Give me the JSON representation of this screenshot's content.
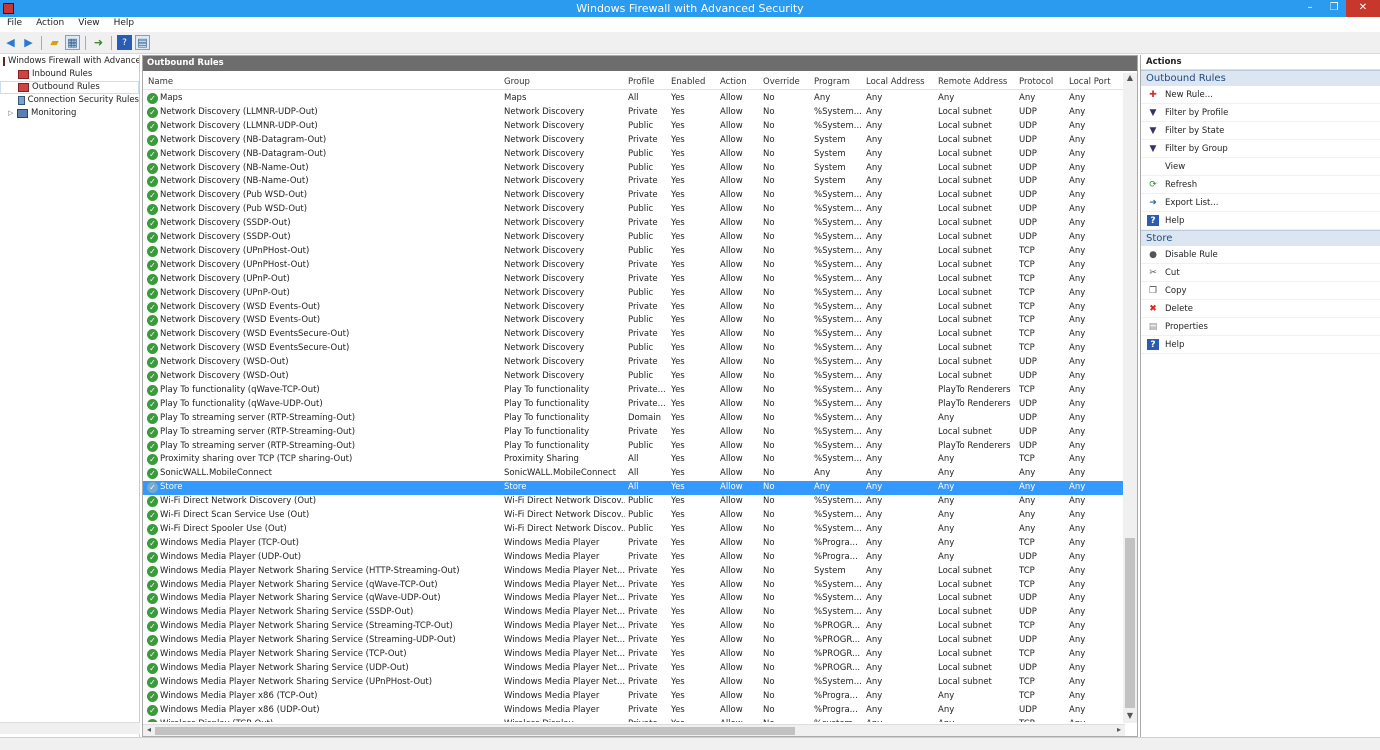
{
  "window": {
    "title": "Windows Firewall with Advanced Security",
    "controls": [
      "–",
      "❐",
      "✕"
    ]
  },
  "menu": [
    "File",
    "Action",
    "View",
    "Help"
  ],
  "tree": {
    "items": [
      {
        "label": "Windows Firewall with Advance",
        "level": 0,
        "expand": ""
      },
      {
        "label": "Inbound Rules",
        "level": 1,
        "expand": ""
      },
      {
        "label": "Outbound Rules",
        "level": 1,
        "expand": ""
      },
      {
        "label": "Connection Security Rules",
        "level": 1,
        "expand": ""
      },
      {
        "label": "Monitoring",
        "level": 1,
        "expand": "▷"
      }
    ]
  },
  "panel": {
    "title": "Outbound Rules"
  },
  "columns": [
    "Name",
    "Group",
    "Profile",
    "Enabled",
    "Action",
    "Override",
    "Program",
    "Local Address",
    "Remote Address",
    "Protocol",
    "Local Port"
  ],
  "rows": [
    [
      "Maps",
      "Maps",
      "All",
      "Yes",
      "Allow",
      "No",
      "Any",
      "Any",
      "Any",
      "Any",
      "Any"
    ],
    [
      "Network Discovery (LLMNR-UDP-Out)",
      "Network Discovery",
      "Private",
      "Yes",
      "Allow",
      "No",
      "%System...",
      "Any",
      "Local subnet",
      "UDP",
      "Any"
    ],
    [
      "Network Discovery (LLMNR-UDP-Out)",
      "Network Discovery",
      "Public",
      "Yes",
      "Allow",
      "No",
      "%System...",
      "Any",
      "Local subnet",
      "UDP",
      "Any"
    ],
    [
      "Network Discovery (NB-Datagram-Out)",
      "Network Discovery",
      "Private",
      "Yes",
      "Allow",
      "No",
      "System",
      "Any",
      "Local subnet",
      "UDP",
      "Any"
    ],
    [
      "Network Discovery (NB-Datagram-Out)",
      "Network Discovery",
      "Public",
      "Yes",
      "Allow",
      "No",
      "System",
      "Any",
      "Local subnet",
      "UDP",
      "Any"
    ],
    [
      "Network Discovery (NB-Name-Out)",
      "Network Discovery",
      "Public",
      "Yes",
      "Allow",
      "No",
      "System",
      "Any",
      "Local subnet",
      "UDP",
      "Any"
    ],
    [
      "Network Discovery (NB-Name-Out)",
      "Network Discovery",
      "Private",
      "Yes",
      "Allow",
      "No",
      "System",
      "Any",
      "Local subnet",
      "UDP",
      "Any"
    ],
    [
      "Network Discovery (Pub WSD-Out)",
      "Network Discovery",
      "Private",
      "Yes",
      "Allow",
      "No",
      "%System...",
      "Any",
      "Local subnet",
      "UDP",
      "Any"
    ],
    [
      "Network Discovery (Pub WSD-Out)",
      "Network Discovery",
      "Public",
      "Yes",
      "Allow",
      "No",
      "%System...",
      "Any",
      "Local subnet",
      "UDP",
      "Any"
    ],
    [
      "Network Discovery (SSDP-Out)",
      "Network Discovery",
      "Private",
      "Yes",
      "Allow",
      "No",
      "%System...",
      "Any",
      "Local subnet",
      "UDP",
      "Any"
    ],
    [
      "Network Discovery (SSDP-Out)",
      "Network Discovery",
      "Public",
      "Yes",
      "Allow",
      "No",
      "%System...",
      "Any",
      "Local subnet",
      "UDP",
      "Any"
    ],
    [
      "Network Discovery (UPnPHost-Out)",
      "Network Discovery",
      "Public",
      "Yes",
      "Allow",
      "No",
      "%System...",
      "Any",
      "Local subnet",
      "TCP",
      "Any"
    ],
    [
      "Network Discovery (UPnPHost-Out)",
      "Network Discovery",
      "Private",
      "Yes",
      "Allow",
      "No",
      "%System...",
      "Any",
      "Local subnet",
      "TCP",
      "Any"
    ],
    [
      "Network Discovery (UPnP-Out)",
      "Network Discovery",
      "Private",
      "Yes",
      "Allow",
      "No",
      "%System...",
      "Any",
      "Local subnet",
      "TCP",
      "Any"
    ],
    [
      "Network Discovery (UPnP-Out)",
      "Network Discovery",
      "Public",
      "Yes",
      "Allow",
      "No",
      "%System...",
      "Any",
      "Local subnet",
      "TCP",
      "Any"
    ],
    [
      "Network Discovery (WSD Events-Out)",
      "Network Discovery",
      "Private",
      "Yes",
      "Allow",
      "No",
      "%System...",
      "Any",
      "Local subnet",
      "TCP",
      "Any"
    ],
    [
      "Network Discovery (WSD Events-Out)",
      "Network Discovery",
      "Public",
      "Yes",
      "Allow",
      "No",
      "%System...",
      "Any",
      "Local subnet",
      "TCP",
      "Any"
    ],
    [
      "Network Discovery (WSD EventsSecure-Out)",
      "Network Discovery",
      "Private",
      "Yes",
      "Allow",
      "No",
      "%System...",
      "Any",
      "Local subnet",
      "TCP",
      "Any"
    ],
    [
      "Network Discovery (WSD EventsSecure-Out)",
      "Network Discovery",
      "Public",
      "Yes",
      "Allow",
      "No",
      "%System...",
      "Any",
      "Local subnet",
      "TCP",
      "Any"
    ],
    [
      "Network Discovery (WSD-Out)",
      "Network Discovery",
      "Private",
      "Yes",
      "Allow",
      "No",
      "%System...",
      "Any",
      "Local subnet",
      "UDP",
      "Any"
    ],
    [
      "Network Discovery (WSD-Out)",
      "Network Discovery",
      "Public",
      "Yes",
      "Allow",
      "No",
      "%System...",
      "Any",
      "Local subnet",
      "UDP",
      "Any"
    ],
    [
      "Play To functionality (qWave-TCP-Out)",
      "Play To functionality",
      "Private...",
      "Yes",
      "Allow",
      "No",
      "%System...",
      "Any",
      "PlayTo Renderers",
      "TCP",
      "Any"
    ],
    [
      "Play To functionality (qWave-UDP-Out)",
      "Play To functionality",
      "Private...",
      "Yes",
      "Allow",
      "No",
      "%System...",
      "Any",
      "PlayTo Renderers",
      "UDP",
      "Any"
    ],
    [
      "Play To streaming server (RTP-Streaming-Out)",
      "Play To functionality",
      "Domain",
      "Yes",
      "Allow",
      "No",
      "%System...",
      "Any",
      "Any",
      "UDP",
      "Any"
    ],
    [
      "Play To streaming server (RTP-Streaming-Out)",
      "Play To functionality",
      "Private",
      "Yes",
      "Allow",
      "No",
      "%System...",
      "Any",
      "Local subnet",
      "UDP",
      "Any"
    ],
    [
      "Play To streaming server (RTP-Streaming-Out)",
      "Play To functionality",
      "Public",
      "Yes",
      "Allow",
      "No",
      "%System...",
      "Any",
      "PlayTo Renderers",
      "UDP",
      "Any"
    ],
    [
      "Proximity sharing over TCP (TCP sharing-Out)",
      "Proximity Sharing",
      "All",
      "Yes",
      "Allow",
      "No",
      "%System...",
      "Any",
      "Any",
      "TCP",
      "Any"
    ],
    [
      "SonicWALL.MobileConnect",
      "SonicWALL.MobileConnect",
      "All",
      "Yes",
      "Allow",
      "No",
      "Any",
      "Any",
      "Any",
      "Any",
      "Any"
    ],
    [
      "Store",
      "Store",
      "All",
      "Yes",
      "Allow",
      "No",
      "Any",
      "Any",
      "Any",
      "Any",
      "Any"
    ],
    [
      "Wi-Fi Direct Network Discovery (Out)",
      "Wi-Fi Direct Network Discov...",
      "Public",
      "Yes",
      "Allow",
      "No",
      "%System...",
      "Any",
      "Any",
      "Any",
      "Any"
    ],
    [
      "Wi-Fi Direct Scan Service Use (Out)",
      "Wi-Fi Direct Network Discov...",
      "Public",
      "Yes",
      "Allow",
      "No",
      "%System...",
      "Any",
      "Any",
      "Any",
      "Any"
    ],
    [
      "Wi-Fi Direct Spooler Use (Out)",
      "Wi-Fi Direct Network Discov...",
      "Public",
      "Yes",
      "Allow",
      "No",
      "%System...",
      "Any",
      "Any",
      "Any",
      "Any"
    ],
    [
      "Windows Media Player (TCP-Out)",
      "Windows Media Player",
      "Private",
      "Yes",
      "Allow",
      "No",
      "%Progra...",
      "Any",
      "Any",
      "TCP",
      "Any"
    ],
    [
      "Windows Media Player (UDP-Out)",
      "Windows Media Player",
      "Private",
      "Yes",
      "Allow",
      "No",
      "%Progra...",
      "Any",
      "Any",
      "UDP",
      "Any"
    ],
    [
      "Windows Media Player Network Sharing Service (HTTP-Streaming-Out)",
      "Windows Media Player Net...",
      "Private",
      "Yes",
      "Allow",
      "No",
      "System",
      "Any",
      "Local subnet",
      "TCP",
      "Any"
    ],
    [
      "Windows Media Player Network Sharing Service (qWave-TCP-Out)",
      "Windows Media Player Net...",
      "Private",
      "Yes",
      "Allow",
      "No",
      "%System...",
      "Any",
      "Local subnet",
      "TCP",
      "Any"
    ],
    [
      "Windows Media Player Network Sharing Service (qWave-UDP-Out)",
      "Windows Media Player Net...",
      "Private",
      "Yes",
      "Allow",
      "No",
      "%System...",
      "Any",
      "Local subnet",
      "UDP",
      "Any"
    ],
    [
      "Windows Media Player Network Sharing Service (SSDP-Out)",
      "Windows Media Player Net...",
      "Private",
      "Yes",
      "Allow",
      "No",
      "%System...",
      "Any",
      "Local subnet",
      "UDP",
      "Any"
    ],
    [
      "Windows Media Player Network Sharing Service (Streaming-TCP-Out)",
      "Windows Media Player Net...",
      "Private",
      "Yes",
      "Allow",
      "No",
      "%PROGR...",
      "Any",
      "Local subnet",
      "TCP",
      "Any"
    ],
    [
      "Windows Media Player Network Sharing Service (Streaming-UDP-Out)",
      "Windows Media Player Net...",
      "Private",
      "Yes",
      "Allow",
      "No",
      "%PROGR...",
      "Any",
      "Local subnet",
      "UDP",
      "Any"
    ],
    [
      "Windows Media Player Network Sharing Service (TCP-Out)",
      "Windows Media Player Net...",
      "Private",
      "Yes",
      "Allow",
      "No",
      "%PROGR...",
      "Any",
      "Local subnet",
      "TCP",
      "Any"
    ],
    [
      "Windows Media Player Network Sharing Service (UDP-Out)",
      "Windows Media Player Net...",
      "Private",
      "Yes",
      "Allow",
      "No",
      "%PROGR...",
      "Any",
      "Local subnet",
      "UDP",
      "Any"
    ],
    [
      "Windows Media Player Network Sharing Service (UPnPHost-Out)",
      "Windows Media Player Net...",
      "Private",
      "Yes",
      "Allow",
      "No",
      "%System...",
      "Any",
      "Local subnet",
      "TCP",
      "Any"
    ],
    [
      "Windows Media Player x86 (TCP-Out)",
      "Windows Media Player",
      "Private",
      "Yes",
      "Allow",
      "No",
      "%Progra...",
      "Any",
      "Any",
      "TCP",
      "Any"
    ],
    [
      "Windows Media Player x86 (UDP-Out)",
      "Windows Media Player",
      "Private",
      "Yes",
      "Allow",
      "No",
      "%Progra...",
      "Any",
      "Any",
      "UDP",
      "Any"
    ],
    [
      "Wireless Display (TCP-Out)",
      "Wireless Display",
      "Private",
      "Yes",
      "Allow",
      "No",
      "%system...",
      "Any",
      "Any",
      "TCP",
      "Any"
    ]
  ],
  "selected_row": "Store",
  "actions": {
    "title": "Actions",
    "sections": [
      {
        "title": "Outbound Rules",
        "items": [
          {
            "label": "New Rule...",
            "icon": "new-rule-icon"
          },
          {
            "label": "Filter by Profile",
            "icon": "filter-icon"
          },
          {
            "label": "Filter by State",
            "icon": "filter-icon"
          },
          {
            "label": "Filter by Group",
            "icon": "filter-icon"
          },
          {
            "label": "View",
            "icon": ""
          },
          {
            "label": "Refresh",
            "icon": "refresh-icon"
          },
          {
            "label": "Export List...",
            "icon": "export-icon"
          },
          {
            "label": "Help",
            "icon": "help-icon"
          }
        ]
      },
      {
        "title": "Store",
        "items": [
          {
            "label": "Disable Rule",
            "icon": "disable-icon"
          },
          {
            "label": "Cut",
            "icon": "cut-icon"
          },
          {
            "label": "Copy",
            "icon": "copy-icon"
          },
          {
            "label": "Delete",
            "icon": "delete-icon"
          },
          {
            "label": "Properties",
            "icon": "properties-icon"
          },
          {
            "label": "Help",
            "icon": "help-icon"
          }
        ]
      }
    ]
  },
  "colors": {
    "titlebar": "#2b9bf0",
    "selection": "#3399ff",
    "rule_enabled": "#3a9b3a",
    "section_bg": "#dbe6f2"
  }
}
